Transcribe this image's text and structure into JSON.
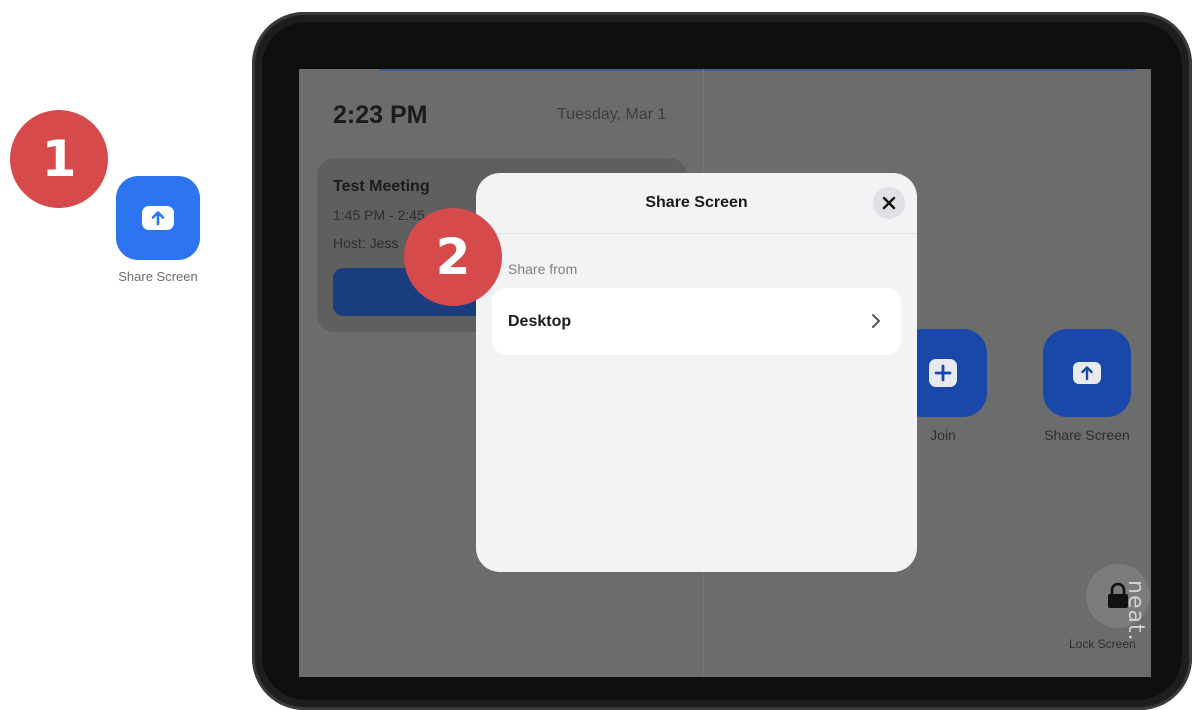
{
  "callouts": {
    "step1": "1",
    "step2": "2"
  },
  "external_button": {
    "label": "Share Screen",
    "icon": "share-up-arrow-icon",
    "color": "#2d74f0"
  },
  "home": {
    "time": "2:23 PM",
    "date": "Tuesday, Mar 1",
    "meeting": {
      "title": "Test Meeting",
      "time_range": "1:45 PM - 2:45",
      "host": "Host: Jess"
    },
    "buttons": {
      "join_label": "Join",
      "share_label": "Share Screen",
      "lock_label": "Lock Screen"
    },
    "brand": "neat."
  },
  "modal": {
    "title": "Share Screen",
    "section_label": "Share from",
    "options": [
      {
        "label": "Desktop"
      }
    ]
  },
  "colors": {
    "badge": "#d64a4c",
    "accent": "#2d74f0"
  }
}
